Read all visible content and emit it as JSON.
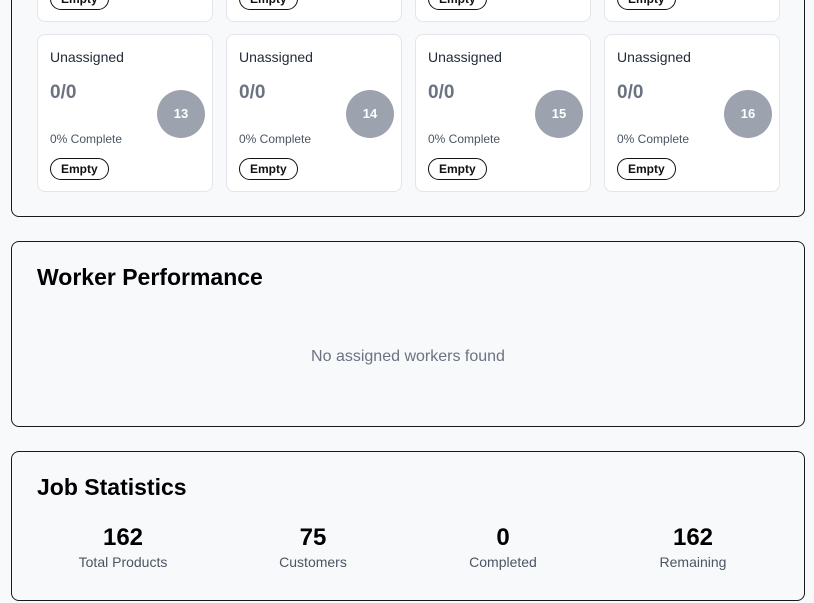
{
  "bins_top_row": [
    {
      "badge": "Empty"
    },
    {
      "badge": "Empty"
    },
    {
      "badge": "Empty"
    },
    {
      "badge": "Empty"
    }
  ],
  "bins": [
    {
      "title": "Unassigned",
      "count": "0/0",
      "percent": "0% Complete",
      "badge": "Empty",
      "number": "13"
    },
    {
      "title": "Unassigned",
      "count": "0/0",
      "percent": "0% Complete",
      "badge": "Empty",
      "number": "14"
    },
    {
      "title": "Unassigned",
      "count": "0/0",
      "percent": "0% Complete",
      "badge": "Empty",
      "number": "15"
    },
    {
      "title": "Unassigned",
      "count": "0/0",
      "percent": "0% Complete",
      "badge": "Empty",
      "number": "16"
    }
  ],
  "worker_performance": {
    "title": "Worker Performance",
    "empty_message": "No assigned workers found"
  },
  "job_statistics": {
    "title": "Job Statistics",
    "stats": [
      {
        "value": "162",
        "label": "Total Products"
      },
      {
        "value": "75",
        "label": "Customers"
      },
      {
        "value": "0",
        "label": "Completed"
      },
      {
        "value": "162",
        "label": "Remaining"
      }
    ]
  }
}
